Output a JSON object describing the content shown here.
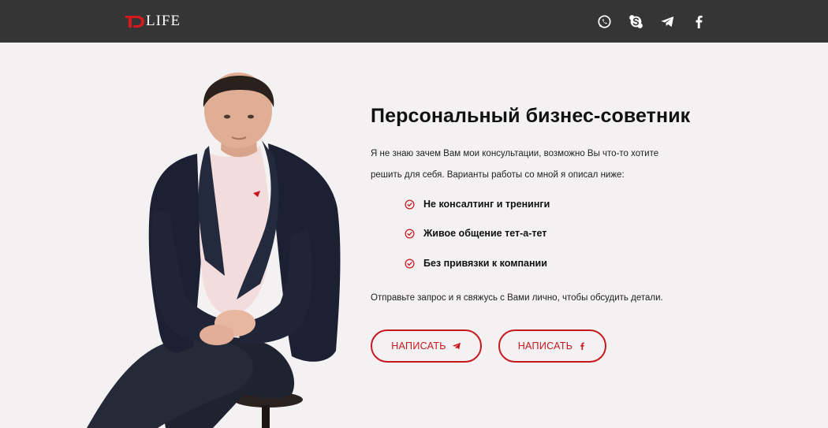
{
  "header": {
    "logo_text": "LIFE",
    "logo_mark_letters": "TD",
    "social": [
      {
        "name": "whatsapp",
        "icon": "whatsapp-icon"
      },
      {
        "name": "skype",
        "icon": "skype-icon"
      },
      {
        "name": "telegram",
        "icon": "telegram-icon"
      },
      {
        "name": "facebook",
        "icon": "facebook-icon"
      }
    ]
  },
  "hero": {
    "title": "Персональный бизнес-советник",
    "intro_line1": "Я не знаю зачем Вам мои консультации, возможно Вы что-то хотите",
    "intro_line2": "решить для себя. Варианты работы со мной я описал ниже:",
    "features": [
      "Не консалтинг и тренинги",
      "Живое общение тет-а-тет",
      "Без привязки к компании"
    ],
    "cta_text": "Отправьте запрос и я свяжусь с Вами лично, чтобы обсудить детали.",
    "buttons": [
      {
        "label": "НАПИСАТЬ",
        "icon": "telegram-icon"
      },
      {
        "label": "НАПИСАТЬ",
        "icon": "facebook-icon"
      }
    ]
  },
  "colors": {
    "topbar": "#353535",
    "background": "#f3f1f1",
    "accent": "#c8171e",
    "text": "#111111"
  }
}
